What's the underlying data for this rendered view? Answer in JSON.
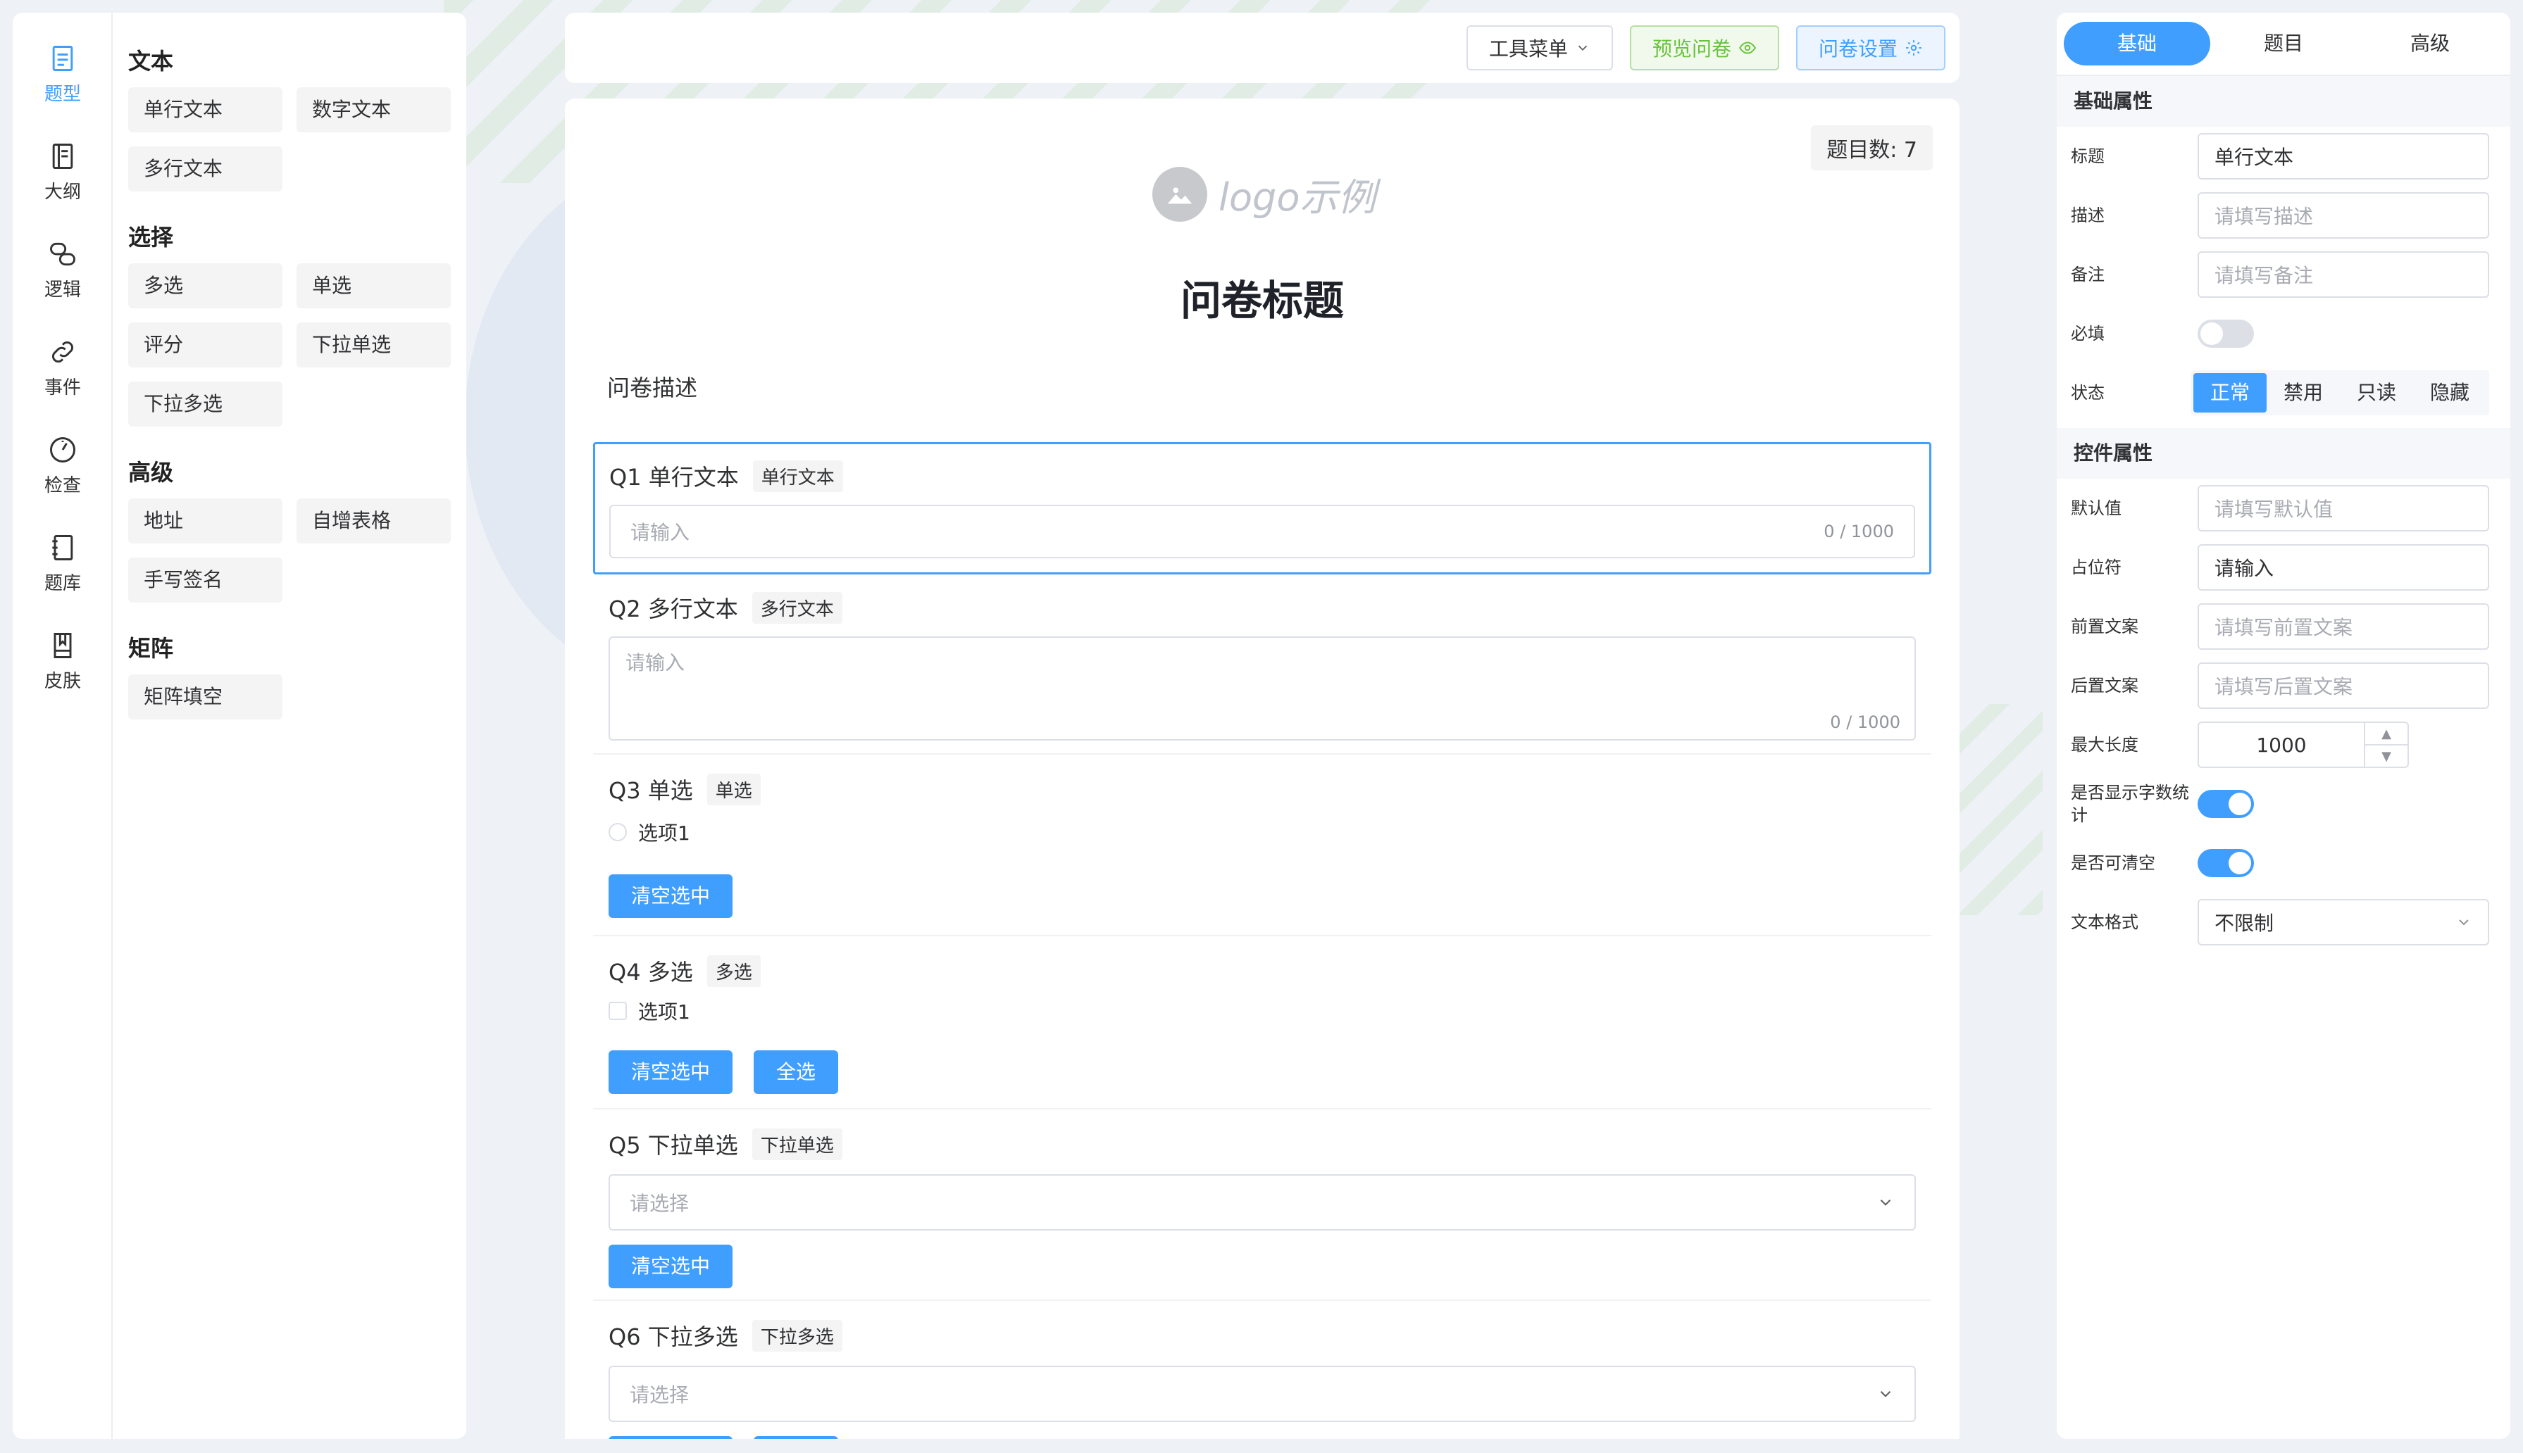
{
  "rail": [
    {
      "label": "题型",
      "icon": "document-icon",
      "active": true
    },
    {
      "label": "大纲",
      "icon": "outline-icon"
    },
    {
      "label": "逻辑",
      "icon": "logic-icon"
    },
    {
      "label": "事件",
      "icon": "link-icon"
    },
    {
      "label": "检查",
      "icon": "gauge-icon"
    },
    {
      "label": "题库",
      "icon": "notebook-icon"
    },
    {
      "label": "皮肤",
      "icon": "skin-icon"
    }
  ],
  "components": {
    "groups": [
      {
        "title": "文本",
        "items": [
          "单行文本",
          "数字文本",
          "多行文本"
        ]
      },
      {
        "title": "选择",
        "items": [
          "多选",
          "单选",
          "评分",
          "下拉单选",
          "下拉多选"
        ]
      },
      {
        "title": "高级",
        "items": [
          "地址",
          "自增表格",
          "手写签名"
        ]
      },
      {
        "title": "矩阵",
        "items": [
          "矩阵填空"
        ]
      }
    ]
  },
  "toolbar": {
    "tools_label": "工具菜单",
    "preview_label": "预览问卷",
    "settings_label": "问卷设置"
  },
  "canvas": {
    "count_label": "题目数: 7",
    "logo_text": "logo示例",
    "title": "问卷标题",
    "description": "问卷描述",
    "questions": [
      {
        "title": "Q1 单行文本",
        "tag": "单行文本",
        "placeholder": "请输入",
        "counter": "0 / 1000"
      },
      {
        "title": "Q2 多行文本",
        "tag": "多行文本",
        "placeholder": "请输入",
        "counter": "0 / 1000"
      },
      {
        "title": "Q3 单选",
        "tag": "单选",
        "option": "选项1",
        "btn_clear": "清空选中"
      },
      {
        "title": "Q4 多选",
        "tag": "多选",
        "option": "选项1",
        "btn_clear": "清空选中",
        "btn_all": "全选"
      },
      {
        "title": "Q5 下拉单选",
        "tag": "下拉单选",
        "placeholder": "请选择",
        "btn_clear": "清空选中"
      },
      {
        "title": "Q6 下拉多选",
        "tag": "下拉多选",
        "placeholder": "请选择"
      }
    ]
  },
  "rpanel": {
    "tabs": [
      "基础",
      "题目",
      "高级"
    ],
    "basic_section": "基础属性",
    "control_section": "控件属性",
    "fields": {
      "title_label": "标题",
      "title_value": "单行文本",
      "desc_label": "描述",
      "desc_placeholder": "请填写描述",
      "note_label": "备注",
      "note_placeholder": "请填写备注",
      "required_label": "必填",
      "status_label": "状态",
      "status_options": [
        "正常",
        "禁用",
        "只读",
        "隐藏"
      ],
      "default_label": "默认值",
      "default_placeholder": "请填写默认值",
      "placeholder_label": "占位符",
      "placeholder_value": "请输入",
      "prefix_label": "前置文案",
      "prefix_placeholder": "请填写前置文案",
      "suffix_label": "后置文案",
      "suffix_placeholder": "请填写后置文案",
      "maxlen_label": "最大长度",
      "maxlen_value": "1000",
      "showcount_label": "是否显示字数统计",
      "clearable_label": "是否可清空",
      "format_label": "文本格式",
      "format_value": "不限制"
    },
    "toggles": {
      "required": false,
      "showcount": true,
      "clearable": true
    }
  },
  "colors": {
    "primary": "#409eff",
    "success": "#67c23a"
  }
}
